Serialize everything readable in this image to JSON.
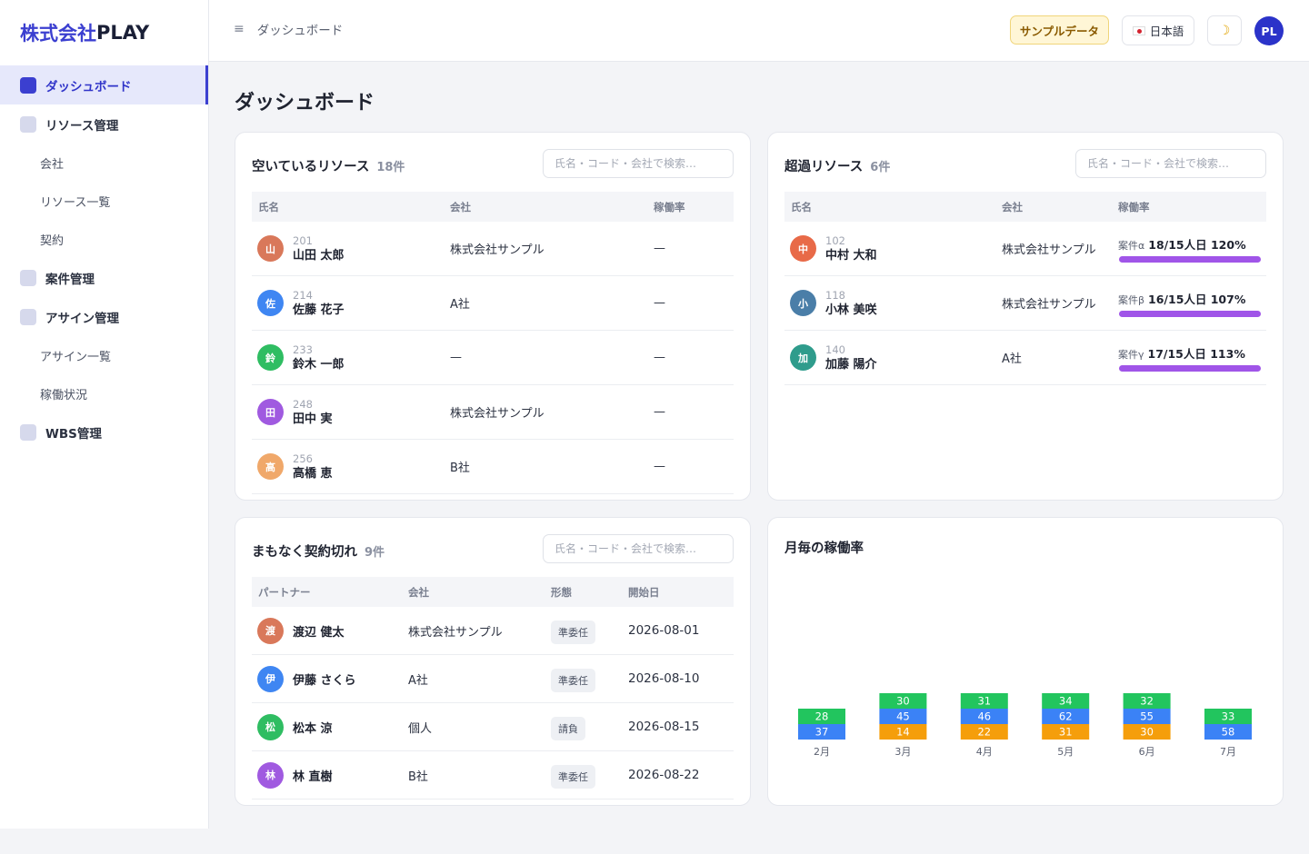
{
  "sidebar": {
    "logo_prefix": "株式会社",
    "logo_suffix": "PLAY",
    "items": [
      {
        "label": "ダッシュボード"
      },
      {
        "label": "リソース管理"
      },
      {
        "label": "会社"
      },
      {
        "label": "リソース一覧"
      },
      {
        "label": "契約"
      },
      {
        "label": "案件管理"
      },
      {
        "label": "アサイン管理"
      },
      {
        "label": "アサイン一覧"
      },
      {
        "label": "稼働状況"
      },
      {
        "label": "WBS管理"
      }
    ]
  },
  "topbar": {
    "menu_icon": "≡",
    "breadcrumb": "ダッシュボード",
    "sample_label": "サンプルデータ",
    "lang_label": "日本語",
    "theme_icon": "☽",
    "avatar": "PL"
  },
  "page_title": "ダッシュボード",
  "available": {
    "title": "空いているリソース",
    "count": "18件",
    "search_placeholder": "氏名・コード・会社で検索…",
    "columns": [
      "氏名",
      "会社",
      "稼働率"
    ],
    "rows": [
      {
        "avatar": "山",
        "color": "#d9785a",
        "code": "201",
        "name": "山田 太郎",
        "company": "株式会社サンプル",
        "rate": "—"
      },
      {
        "avatar": "佐",
        "color": "#3f86f2",
        "code": "214",
        "name": "佐藤 花子",
        "company": "A社",
        "rate": "—"
      },
      {
        "avatar": "鈴",
        "color": "#2fbd62",
        "code": "233",
        "name": "鈴木 一郎",
        "company": "—",
        "rate": "—"
      },
      {
        "avatar": "田",
        "color": "#a05ae0",
        "code": "248",
        "name": "田中 実",
        "company": "株式会社サンプル",
        "rate": "—"
      },
      {
        "avatar": "高",
        "color": "#f0a86a",
        "code": "256",
        "name": "高橋 恵",
        "company": "B社",
        "rate": "—"
      }
    ]
  },
  "over": {
    "title": "超過リソース",
    "count": "6件",
    "search_placeholder": "氏名・コード・会社で検索…",
    "columns": [
      "氏名",
      "会社",
      "稼働率"
    ],
    "rows": [
      {
        "avatar": "中",
        "color": "#e86a48",
        "code": "102",
        "name": "中村 大和",
        "company": "株式会社サンプル",
        "project": "案件α",
        "detail": "18/15人日 120%",
        "pct": 120
      },
      {
        "avatar": "小",
        "color": "#4a7ea8",
        "code": "118",
        "name": "小林 美咲",
        "company": "株式会社サンプル",
        "project": "案件β",
        "detail": "16/15人日 107%",
        "pct": 107
      },
      {
        "avatar": "加",
        "color": "#2f9c8c",
        "code": "140",
        "name": "加藤 陽介",
        "company": "A社",
        "project": "案件γ",
        "detail": "17/15人日 113%",
        "pct": 113
      }
    ]
  },
  "expiring": {
    "title": "まもなく契約切れ",
    "count": "9件",
    "search_placeholder": "氏名・コード・会社で検索…",
    "columns": [
      "パートナー",
      "会社",
      "形態",
      "開始日"
    ],
    "rows": [
      {
        "avatar": "渡",
        "color": "#d9785a",
        "name": "渡辺 健太",
        "company": "株式会社サンプル",
        "type": "準委任",
        "date": "2026-08-01"
      },
      {
        "avatar": "伊",
        "color": "#3f86f2",
        "name": "伊藤 さくら",
        "company": "A社",
        "type": "準委任",
        "date": "2026-08-10"
      },
      {
        "avatar": "松",
        "color": "#2fbd62",
        "name": "松本 涼",
        "company": "個人",
        "type": "請負",
        "date": "2026-08-15"
      },
      {
        "avatar": "林",
        "color": "#a05ae0",
        "name": "林 直樹",
        "company": "B社",
        "type": "準委任",
        "date": "2026-08-22"
      }
    ]
  },
  "monthly": {
    "title": "月毎の稼働率"
  },
  "chart_data": {
    "type": "bar",
    "stacked": true,
    "categories": [
      "2月",
      "3月",
      "4月",
      "5月",
      "6月",
      "7月"
    ],
    "series": [
      {
        "color": "#f59e0b",
        "values": [
          null,
          14,
          22,
          31,
          30,
          null
        ]
      },
      {
        "color": "#3b82f6",
        "values": [
          37,
          45,
          46,
          62,
          55,
          58
        ]
      },
      {
        "color": "#22c55e",
        "values": [
          28,
          30,
          31,
          34,
          32,
          33
        ]
      }
    ],
    "title": "月毎の稼働率",
    "legend": "none"
  },
  "colors": {
    "accent": "#3b3fd0",
    "over_bar": "#a055e8",
    "sample_bg": "#fff6d6"
  }
}
